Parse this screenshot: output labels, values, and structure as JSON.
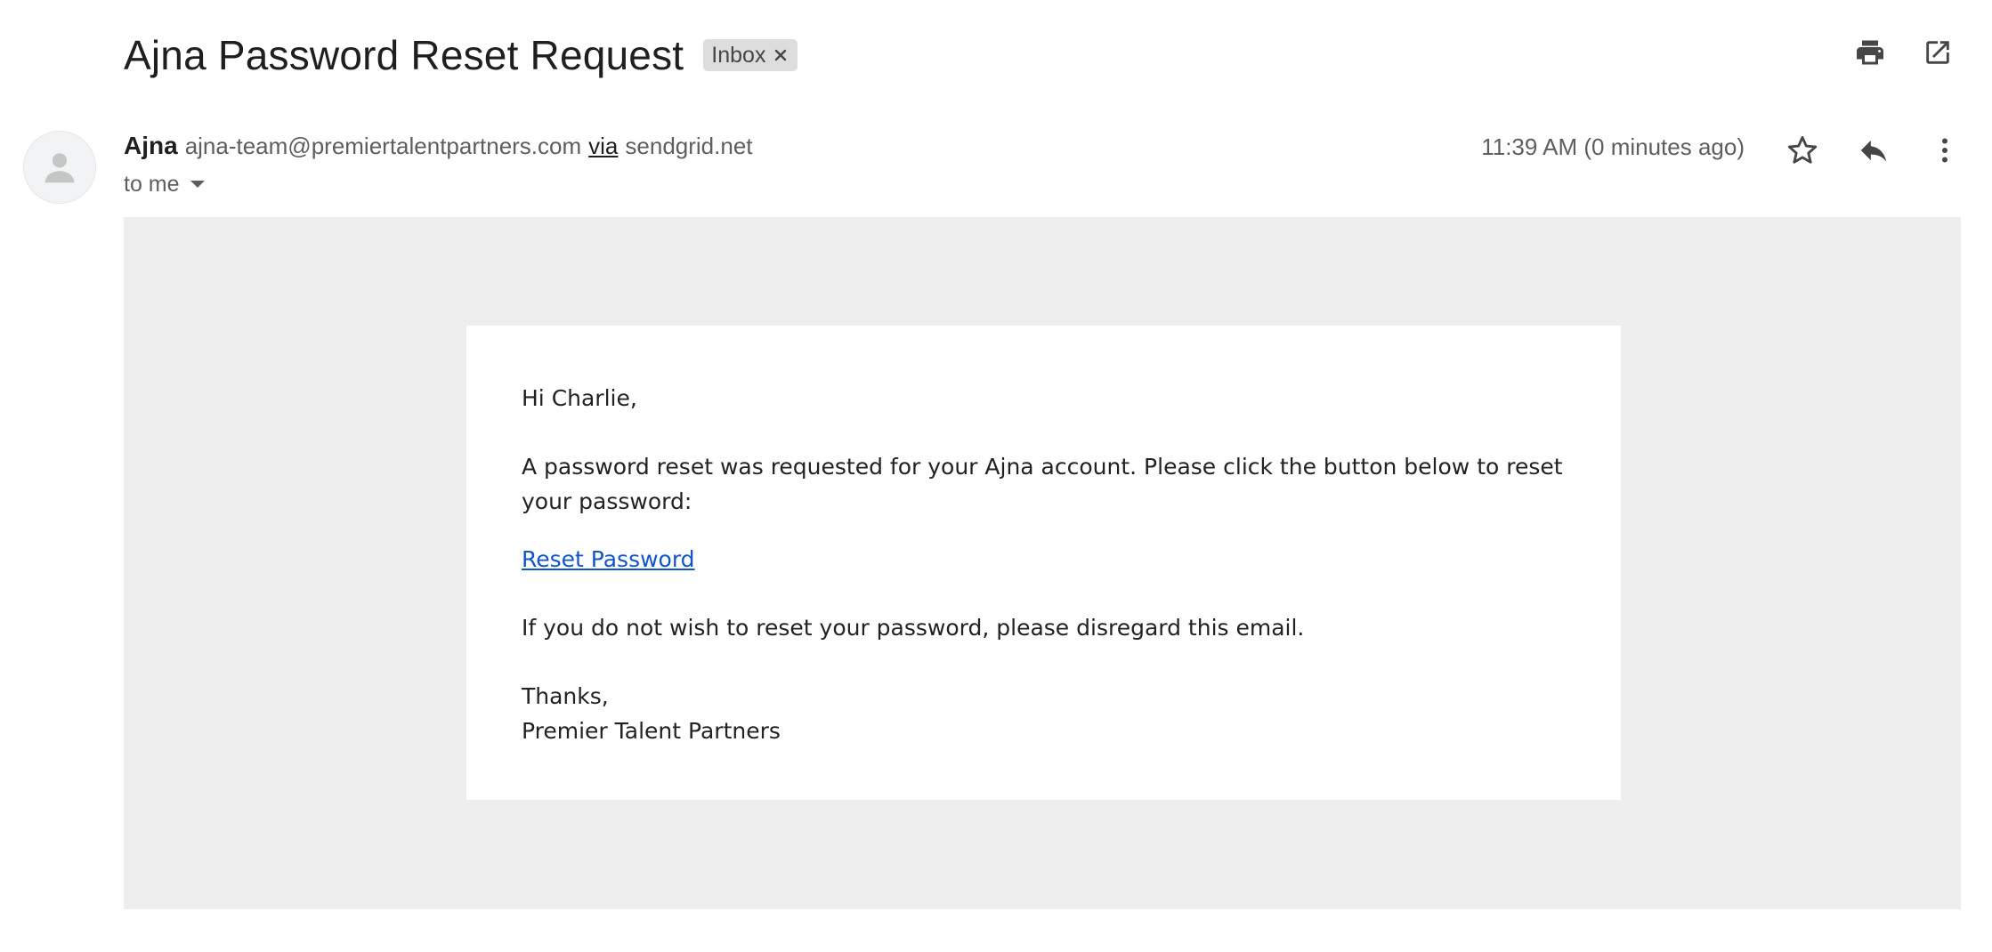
{
  "email": {
    "subject": "Ajna Password Reset Request",
    "label": "Inbox",
    "sender_name": "Ajna",
    "sender_email": "ajna-team@premiertalentpartners.com",
    "via_label": "via",
    "via_domain": "sendgrid.net",
    "recipient": "to me",
    "timestamp": "11:39 AM (0 minutes ago)"
  },
  "body": {
    "greeting": "Hi Charlie,",
    "paragraph1": "A password reset was requested for your Ajna account. Please click the button below to reset your password:",
    "link_text": "Reset Password",
    "paragraph2": "If you do not wish to reset your password, please disregard this email.",
    "closing": "Thanks,",
    "signature": "Premier Talent Partners"
  },
  "icons": {
    "print": "print-icon",
    "open_new_window": "open-in-new-window-icon",
    "star": "star-icon",
    "reply": "reply-icon",
    "more": "more-vert-icon",
    "avatar": "person-icon",
    "remove_label": "close-icon"
  },
  "colors": {
    "link": "#1155cc",
    "frame_background": "#eeeeee",
    "label_chip": "#dddddd"
  }
}
